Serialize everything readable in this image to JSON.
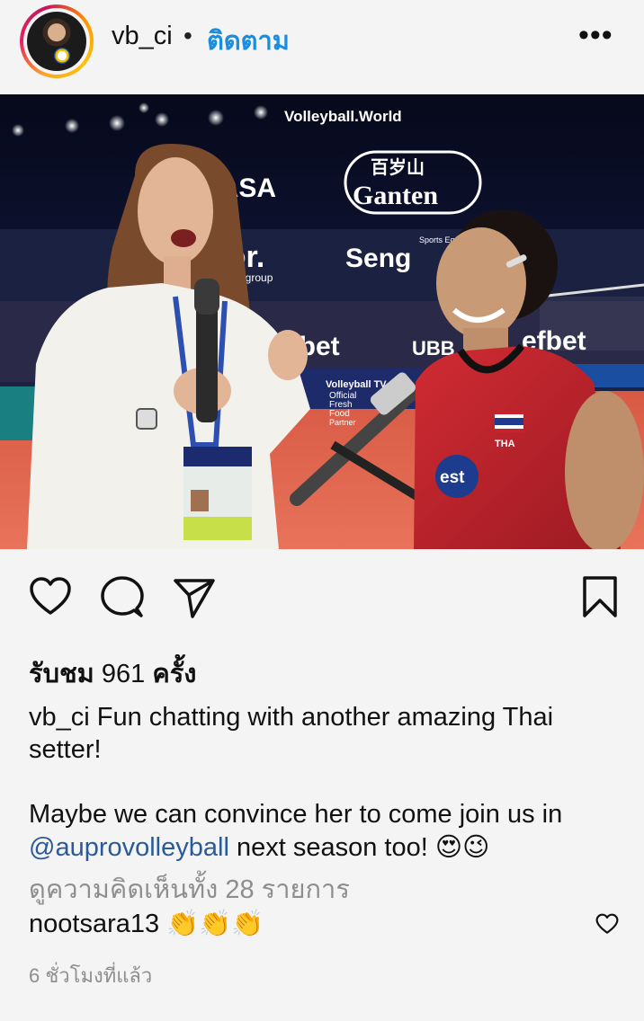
{
  "header": {
    "username": "vb_ci",
    "separator": "•",
    "follow_label": "ติดตาม",
    "more_label": "•••"
  },
  "media": {
    "sponsor_texts": [
      "Volleyball.World",
      "KASA",
      "百岁山",
      "Ganten",
      "flor.",
      "flooringroup",
      "Seng",
      "Sports Equipm",
      "efbet",
      "UBB",
      "efbet",
      "Volleyball TV",
      "Official",
      "Fresh",
      "Food",
      "Partner",
      "THA",
      "est"
    ],
    "colors": {
      "court": "#e4634a",
      "jersey": "#c8232c",
      "shirt": "#f3f1ec"
    }
  },
  "actions": {
    "like_icon": "heart-icon",
    "comment_icon": "comment-icon",
    "share_icon": "send-icon",
    "save_icon": "bookmark-icon"
  },
  "stats": {
    "views_prefix": "รับชม",
    "views_count": "961",
    "views_suffix": "ครั้ง"
  },
  "caption": {
    "username": "vb_ci",
    "line1": "Fun chatting with another amazing Thai setter!",
    "line2_before": "Maybe we can convince her to come join us in",
    "mention": "@auprovolleyball",
    "line2_after": "next season too!",
    "emojis": "😍😉"
  },
  "comments": {
    "view_all": "ดูความคิดเห็นทั้ง 28 รายการ",
    "top_comment_user": "nootsara13",
    "top_comment_text": "👏👏👏"
  },
  "time_ago": "6 ชั่วโมงที่แล้ว",
  "colors": {
    "link": "#1b8ddf",
    "mention": "#2a5a9a",
    "muted": "#8e8e8e"
  }
}
